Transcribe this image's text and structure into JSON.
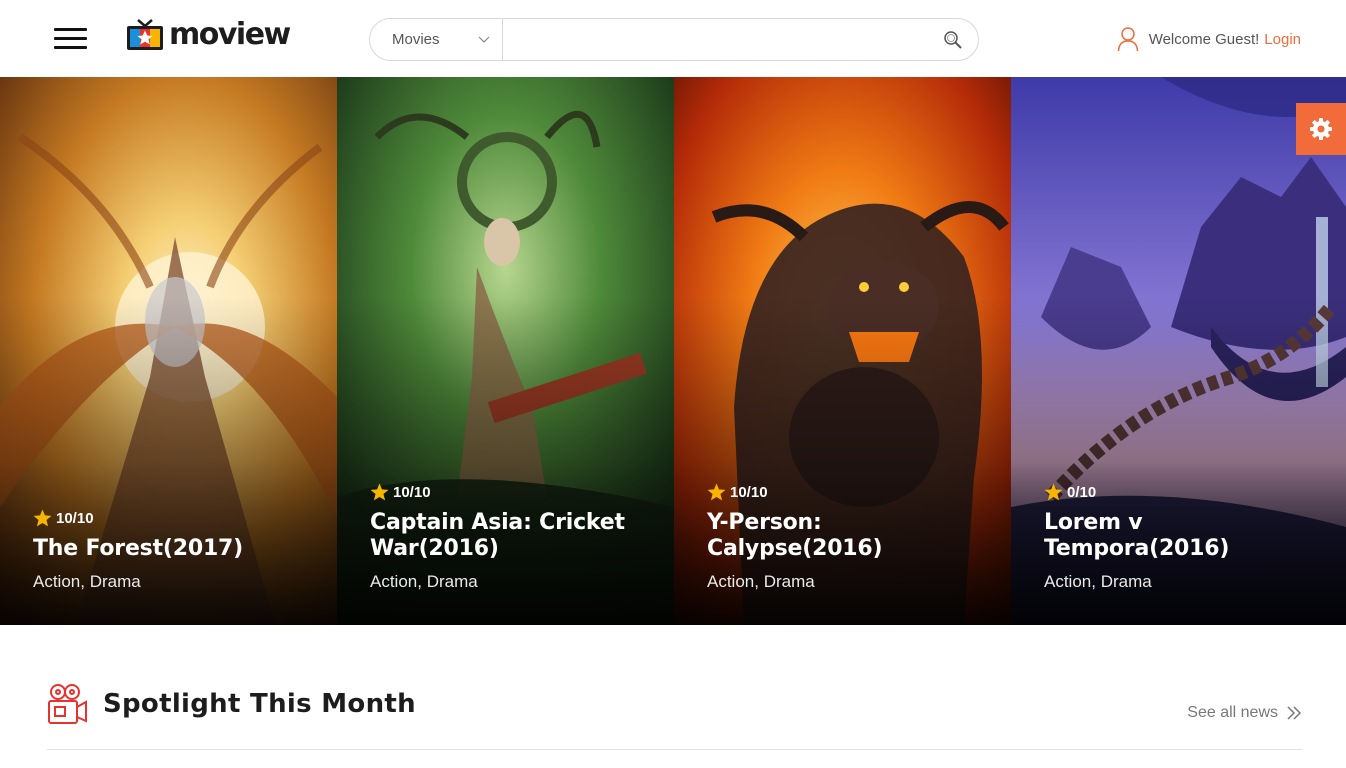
{
  "header": {
    "menu_icon": "hamburger-icon",
    "logo_text": "moview",
    "search": {
      "category": "Movies",
      "value": "",
      "placeholder": ""
    },
    "user": {
      "welcome": "Welcome Guest!",
      "login": "Login"
    }
  },
  "colors": {
    "accent": "#f26b3a",
    "star": "#f7b500",
    "text_dark": "#1d1d1d"
  },
  "hero": {
    "cards": [
      {
        "rating": "10/10",
        "title": "The Forest(2017)",
        "genres": "Action, Drama",
        "art": "golden-winged-creature"
      },
      {
        "rating": "10/10",
        "title": "Captain Asia: Cricket War(2016)",
        "genres": "Action, Drama",
        "art": "green-horned-warrior"
      },
      {
        "rating": "10/10",
        "title": "Y-Person: Calypse(2016)",
        "genres": "Action, Drama",
        "art": "fire-beast"
      },
      {
        "rating": "0/10",
        "title": "Lorem v Tempora(2016)",
        "genres": "Action, Drama",
        "art": "floating-castle"
      }
    ],
    "settings_icon": "gear-icon"
  },
  "spotlight": {
    "title": "Spotlight This Month",
    "see_all": "See all news",
    "icon": "film-camera-icon"
  }
}
